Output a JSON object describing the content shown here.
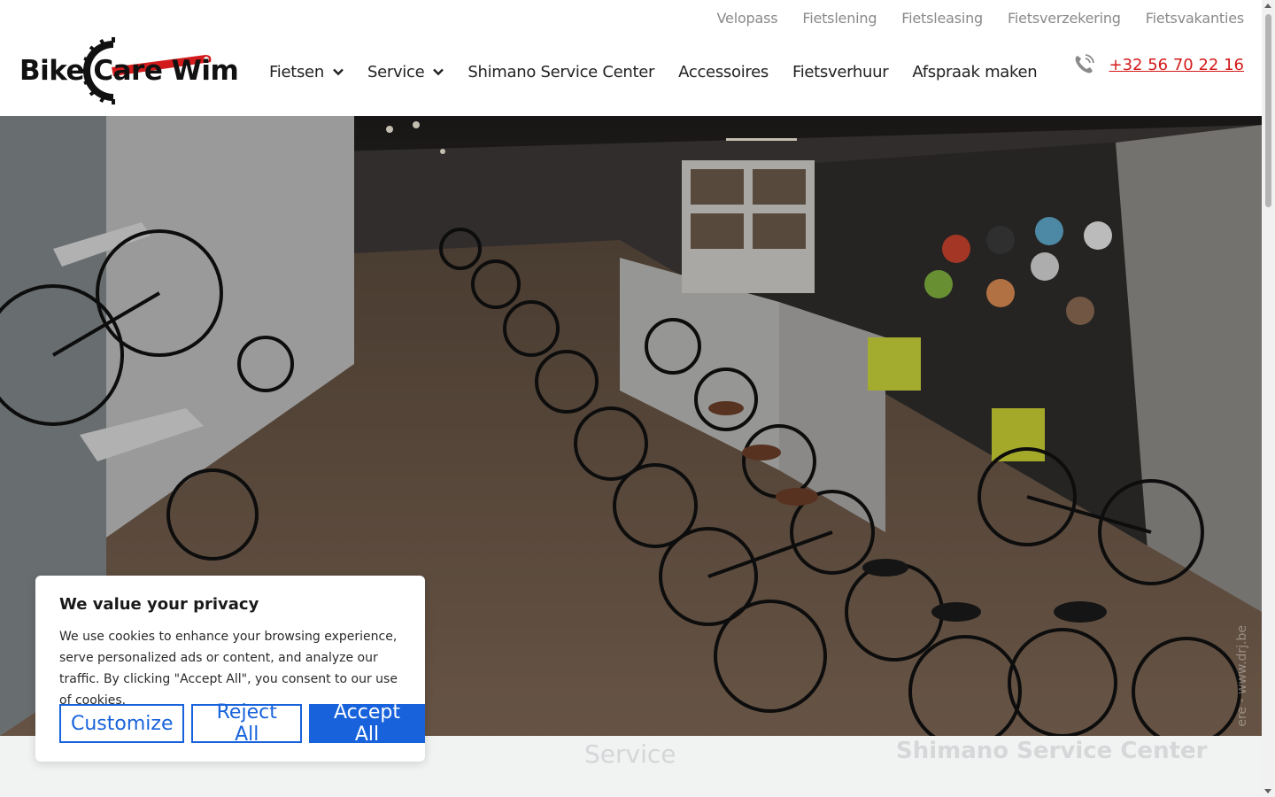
{
  "topbar": {
    "links": [
      "Velopass",
      "Fietslening",
      "Fietsleasing",
      "Fietsverzekering",
      "Fietsvakanties"
    ]
  },
  "logo": {
    "text": "Bike Care Wim"
  },
  "nav": {
    "items": [
      {
        "label": "Fietsen",
        "dropdown": true
      },
      {
        "label": "Service",
        "dropdown": true
      },
      {
        "label": "Shimano Service Center",
        "dropdown": false
      },
      {
        "label": "Accessoires",
        "dropdown": false
      },
      {
        "label": "Fietsverhuur",
        "dropdown": false
      },
      {
        "label": "Afspraak maken",
        "dropdown": false
      }
    ]
  },
  "phone": {
    "number": "+32 56 70 22 16",
    "icon": "phone-icon"
  },
  "hero": {
    "watermark": "ere - www.drj.be"
  },
  "below": {
    "left_title": "Service",
    "right_title": "Shimano Service Center"
  },
  "cookie": {
    "title": "We value your privacy",
    "body": "We use cookies to enhance your browsing experience, serve personalized ads or content, and analyze our traffic. By clicking \"Accept All\", you consent to our use of cookies.",
    "customize_label": "Customize",
    "reject_label": "Reject All",
    "accept_label": "Accept All"
  },
  "colors": {
    "accent_red": "#d41b1b",
    "cookie_blue": "#1863dc"
  }
}
